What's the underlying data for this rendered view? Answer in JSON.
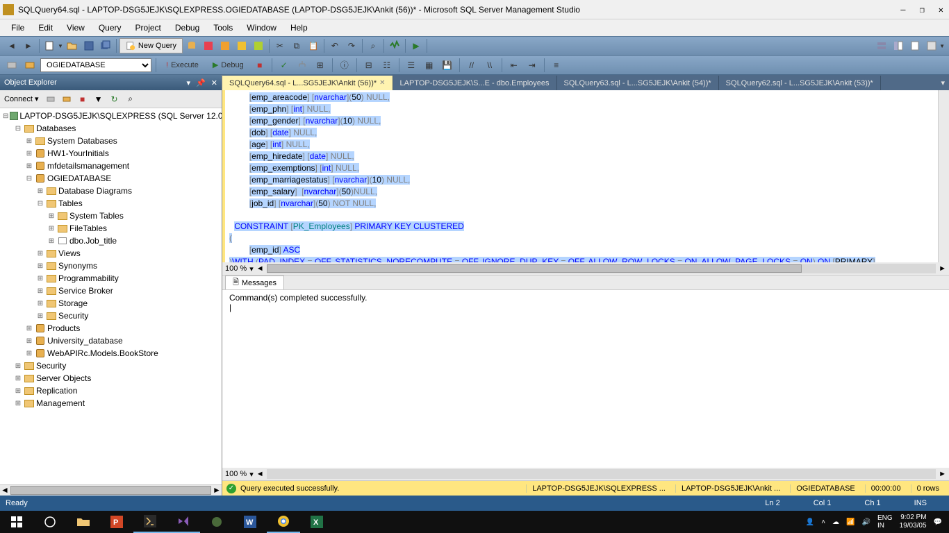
{
  "window": {
    "title": "SQLQuery64.sql - LAPTOP-DSG5JEJK\\SQLEXPRESS.OGIEDATABASE (LAPTOP-DSG5JEJK\\Ankit (56))* - Microsoft SQL Server Management Studio"
  },
  "menu": [
    "File",
    "Edit",
    "View",
    "Query",
    "Project",
    "Debug",
    "Tools",
    "Window",
    "Help"
  ],
  "toolbar": {
    "new_query": "New Query",
    "db_selected": "OGIEDATABASE",
    "execute": "Execute",
    "debug": "Debug"
  },
  "obj_explorer": {
    "title": "Object Explorer",
    "connect_label": "Connect ▾",
    "root": "LAPTOP-DSG5JEJK\\SQLEXPRESS (SQL Server 12.0.2",
    "nodes": {
      "databases": "Databases",
      "sysdb": "System Databases",
      "hw1": "HW1-YourInitials",
      "mfd": "mfdetailsmanagement",
      "ogie": "OGIEDATABASE",
      "diagrams": "Database Diagrams",
      "tables": "Tables",
      "systables": "System Tables",
      "filetables": "FileTables",
      "jobtitle": "dbo.Job_title",
      "views": "Views",
      "synonyms": "Synonyms",
      "programmability": "Programmability",
      "servicebroker": "Service Broker",
      "storage": "Storage",
      "security_db": "Security",
      "products": "Products",
      "university": "University_database",
      "webapi": "WebAPIRc.Models.BookStore",
      "security": "Security",
      "serverobj": "Server Objects",
      "replication": "Replication",
      "management": "Management"
    }
  },
  "tabs": [
    {
      "label": "SQLQuery64.sql - L...SG5JEJK\\Ankit (56))*",
      "active": true
    },
    {
      "label": "LAPTOP-DSG5JEJK\\S...E - dbo.Employees",
      "active": false
    },
    {
      "label": "SQLQuery63.sql - L...SG5JEJK\\Ankit (54))*",
      "active": false
    },
    {
      "label": "SQLQuery62.sql - L...SG5JEJK\\Ankit (53))*",
      "active": false
    }
  ],
  "zoom": "100 %",
  "messages": {
    "tab": "Messages",
    "text": "Command(s) completed successfully."
  },
  "exec_status": {
    "text": "Query executed successfully.",
    "server": "LAPTOP-DSG5JEJK\\SQLEXPRESS ...",
    "user": "LAPTOP-DSG5JEJK\\Ankit ...",
    "db": "OGIEDATABASE",
    "time": "00:00:00",
    "rows": "0 rows"
  },
  "app_status": {
    "ready": "Ready",
    "ln": "Ln 2",
    "col": "Col 1",
    "ch": "Ch 1",
    "ins": "INS"
  },
  "tray": {
    "lang": "ENG",
    "locale": "IN",
    "time": "9:02 PM",
    "date": "19/03/05"
  }
}
